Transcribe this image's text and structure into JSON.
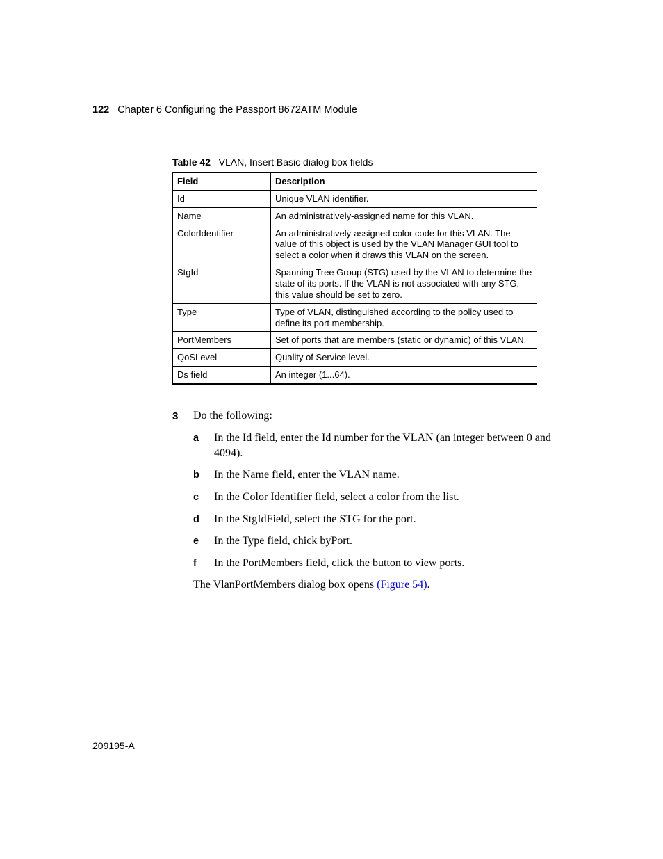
{
  "header": {
    "page_number": "122",
    "running_head": "Chapter 6  Configuring the Passport 8672ATM Module"
  },
  "table": {
    "caption_label": "Table 42",
    "caption_text": "VLAN, Insert Basic dialog box fields",
    "headers": {
      "col1": "Field",
      "col2": "Description"
    },
    "rows": [
      {
        "field": "Id",
        "desc": "Unique VLAN identifier."
      },
      {
        "field": "Name",
        "desc": "An administratively-assigned name for this VLAN."
      },
      {
        "field": "ColorIdentifier",
        "desc": "An administratively-assigned color code for this VLAN. The value of this object is used by the VLAN Manager GUI tool to select a color when it draws this VLAN on the screen."
      },
      {
        "field": "StgId",
        "desc": "Spanning Tree Group (STG) used by the VLAN to determine the state of its ports. If the VLAN is not associated with any STG, this value should be set to zero."
      },
      {
        "field": "Type",
        "desc": "Type of VLAN, distinguished according to the policy used to define its port membership."
      },
      {
        "field": "PortMembers",
        "desc": "Set of ports that are members (static or dynamic) of this VLAN."
      },
      {
        "field": "QoSLevel",
        "desc": "Quality of Service level."
      },
      {
        "field": "Ds field",
        "desc": "An integer (1...64)."
      }
    ]
  },
  "steps": {
    "num": "3",
    "lead": "Do the following:",
    "items": [
      {
        "letter": "a",
        "text": "In the Id field, enter the Id number for the VLAN (an integer between 0 and 4094)."
      },
      {
        "letter": "b",
        "text": "In the Name field, enter the VLAN name."
      },
      {
        "letter": "c",
        "text": "In the Color Identifier field, select a color from the list."
      },
      {
        "letter": "d",
        "text": "In the StgIdField, select the STG for the port."
      },
      {
        "letter": "e",
        "text": "In the Type field, chick byPort."
      },
      {
        "letter": "f",
        "text": "In the PortMembers field, click the button to view ports."
      }
    ],
    "followup_prefix": "The VlanPortMembers dialog box opens ",
    "followup_link": "(Figure 54)",
    "followup_suffix": "."
  },
  "footer": {
    "doc_id": "209195-A"
  }
}
